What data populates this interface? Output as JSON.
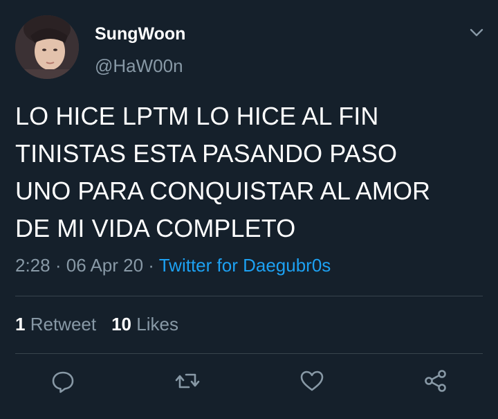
{
  "user": {
    "display_name": "SungWoon",
    "handle": "@HaW00n",
    "avatar": "profile-photo"
  },
  "tweet": {
    "lines": [
      "LO HICE LPTM LO HICE AL FIN",
      "TINISTAS ESTA PASANDO PASO",
      "UNO PARA CONQUISTAR AL AMOR",
      "DE MI VIDA COMPLETO"
    ],
    "time": "2:28",
    "separator": "·",
    "date": "06 Apr 20",
    "source": "Twitter for Daegubr0s"
  },
  "stats": {
    "retweets_count": "1",
    "retweets_label": "Retweet",
    "likes_count": "10",
    "likes_label": "Likes"
  },
  "actions": {
    "icons": [
      "reply-icon",
      "retweet-icon",
      "like-icon",
      "share-icon"
    ]
  },
  "colors": {
    "background": "#15202b",
    "text_primary": "#ffffff",
    "text_secondary": "#8899a6",
    "accent": "#1da1f2",
    "divider": "#38444d"
  }
}
